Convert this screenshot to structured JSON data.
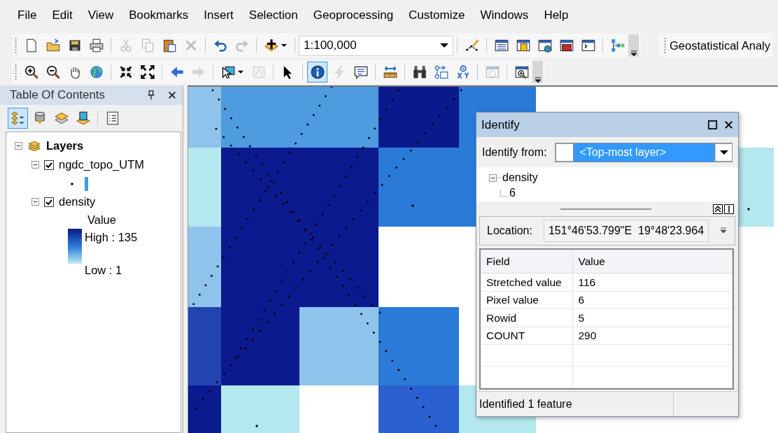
{
  "menu": [
    {
      "label": "File"
    },
    {
      "label": "Edit"
    },
    {
      "label": "View"
    },
    {
      "label": "Bookmarks"
    },
    {
      "label": "Insert"
    },
    {
      "label": "Selection"
    },
    {
      "label": "Geoprocessing"
    },
    {
      "label": "Customize"
    },
    {
      "label": "Windows"
    },
    {
      "label": "Help"
    }
  ],
  "toolbars": [
    {
      "items": [
        {
          "kind": "new",
          "disabled": false
        },
        {
          "kind": "open",
          "disabled": false
        },
        {
          "kind": "save",
          "disabled": false
        },
        {
          "kind": "print",
          "disabled": false
        },
        {
          "kind": "sep"
        },
        {
          "kind": "cut",
          "disabled": true
        },
        {
          "kind": "copy",
          "disabled": true
        },
        {
          "kind": "paste",
          "disabled": false
        },
        {
          "kind": "delete",
          "disabled": true
        },
        {
          "kind": "sep"
        },
        {
          "kind": "undo",
          "disabled": false
        },
        {
          "kind": "redo",
          "disabled": true
        },
        {
          "kind": "sep"
        },
        {
          "kind": "add-data",
          "disabled": false
        },
        {
          "kind": "sep"
        },
        {
          "kind": "combo",
          "value": "1:100,000"
        },
        {
          "kind": "sep"
        },
        {
          "kind": "editor",
          "disabled": false
        },
        {
          "kind": "sep"
        },
        {
          "kind": "table",
          "disabled": false
        },
        {
          "kind": "catalog",
          "disabled": false
        },
        {
          "kind": "search",
          "disabled": false
        },
        {
          "kind": "toolbox",
          "disabled": false
        },
        {
          "kind": "python",
          "disabled": false
        },
        {
          "kind": "sep"
        },
        {
          "kind": "model",
          "disabled": false
        },
        {
          "kind": "overflow"
        }
      ]
    },
    {
      "items": [
        {
          "kind": "zoom-in",
          "disabled": false,
          "selected": false
        },
        {
          "kind": "zoom-out",
          "disabled": false,
          "selected": false
        },
        {
          "kind": "pan",
          "disabled": false,
          "selected": false
        },
        {
          "kind": "globe",
          "disabled": false,
          "selected": false
        },
        {
          "kind": "sep"
        },
        {
          "kind": "fixed-in",
          "disabled": false,
          "selected": false
        },
        {
          "kind": "fixed-out",
          "disabled": false,
          "selected": false
        },
        {
          "kind": "sep"
        },
        {
          "kind": "back",
          "disabled": false,
          "selected": false
        },
        {
          "kind": "forward",
          "disabled": true,
          "selected": false
        },
        {
          "kind": "sep"
        },
        {
          "kind": "select",
          "disabled": false,
          "selected": false
        },
        {
          "kind": "clear-select",
          "disabled": true,
          "selected": false
        },
        {
          "kind": "sep"
        },
        {
          "kind": "pointer",
          "disabled": false,
          "selected": false
        },
        {
          "kind": "sep"
        },
        {
          "kind": "identify",
          "disabled": false,
          "selected": true
        },
        {
          "kind": "lightning",
          "disabled": true,
          "selected": false
        },
        {
          "kind": "popup",
          "disabled": false,
          "selected": false
        },
        {
          "kind": "sep"
        },
        {
          "kind": "measure",
          "disabled": false,
          "selected": false
        },
        {
          "kind": "sep"
        },
        {
          "kind": "find",
          "disabled": false,
          "selected": false
        },
        {
          "kind": "route",
          "disabled": false,
          "selected": false
        },
        {
          "kind": "xy",
          "disabled": false,
          "selected": false
        },
        {
          "kind": "sep"
        },
        {
          "kind": "time",
          "disabled": true,
          "selected": false
        },
        {
          "kind": "sep"
        },
        {
          "kind": "magnifier",
          "disabled": false,
          "selected": false
        },
        {
          "kind": "overflow"
        }
      ]
    }
  ],
  "geostat_toolbar": {
    "label": "Geostatistical Analy"
  },
  "toc": {
    "title": "Table Of Contents",
    "tools": [
      {
        "kind": "drawing-order",
        "selected": true
      },
      {
        "kind": "source",
        "selected": false
      },
      {
        "kind": "visibility",
        "selected": false
      },
      {
        "kind": "selection",
        "selected": false
      },
      {
        "kind": "sep"
      },
      {
        "kind": "options",
        "selected": false
      }
    ],
    "tree": [
      {
        "label": "Layers",
        "kind": "frame",
        "expanded": true,
        "children": [
          {
            "label": "ngdc_topo_UTM",
            "kind": "points",
            "checked": true,
            "expanded": true
          },
          {
            "label": "density",
            "kind": "raster",
            "checked": true,
            "expanded": true,
            "legend": {
              "field": "Value",
              "high": "High : 135",
              "low": "Low : 1"
            }
          }
        ]
      }
    ]
  },
  "identify": {
    "title": "Identify",
    "from_label": "Identify from:",
    "from_value": "<Top-most layer>",
    "tree": [
      {
        "label": "density",
        "expanded": true,
        "children": [
          {
            "label": "6"
          }
        ]
      }
    ],
    "location_label": "Location:",
    "location_value": "151°46'53.799\"E  19°48'23.964",
    "columns": [
      "Field",
      "Value"
    ],
    "rows": [
      [
        "Stretched value",
        "116"
      ],
      [
        "Pixel value",
        "6"
      ],
      [
        "Rowid",
        "5"
      ],
      [
        "COUNT",
        "290"
      ]
    ],
    "status": "Identified 1 feature"
  }
}
